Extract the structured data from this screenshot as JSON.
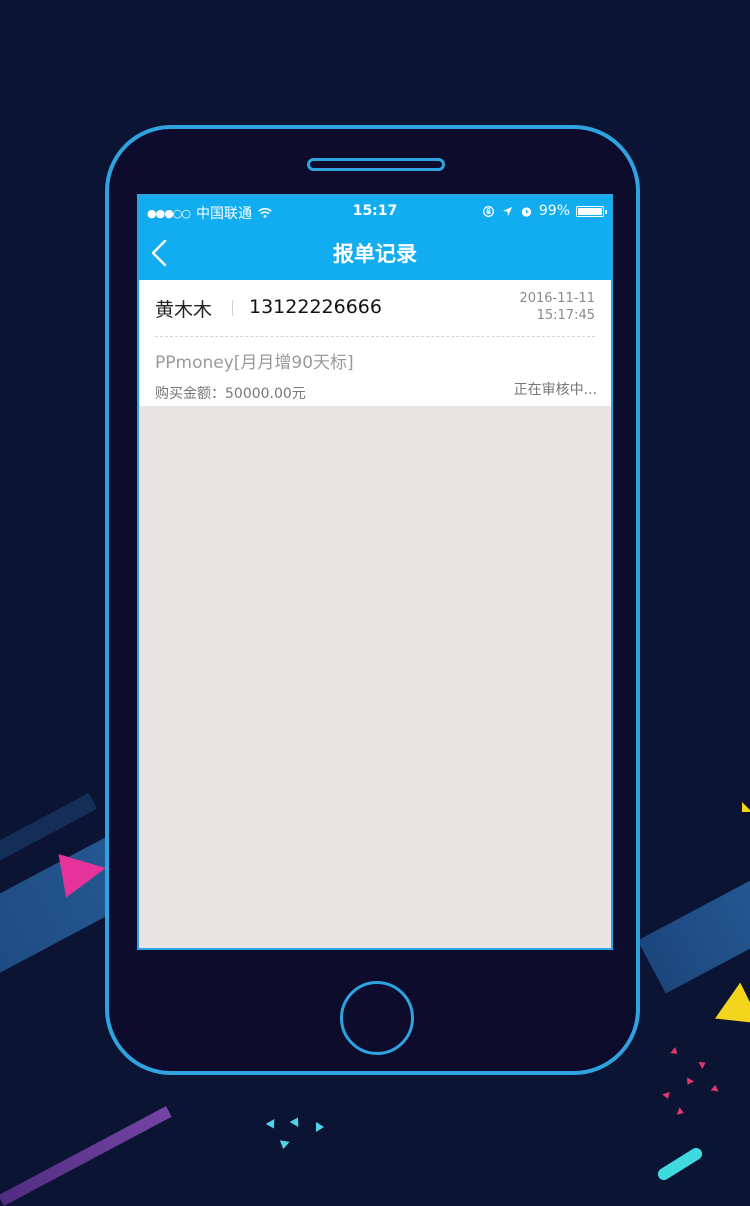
{
  "status_bar": {
    "signal": "●●●○○",
    "carrier": "中国联通",
    "time": "15:17",
    "battery": "99%",
    "battery_level": 0.99
  },
  "nav": {
    "title": "报单记录"
  },
  "records": [
    {
      "name": "黄木木",
      "phone": "13122226666",
      "date": "2016-11-11",
      "time": "15:17:45",
      "product": "PPmoney[月月增90天标]",
      "amount": "购买金额：50000.00元",
      "status": "正在审核中..."
    }
  ],
  "colors": {
    "background": "#0b1433",
    "phone_outline": "#2ea3e0",
    "header": "#12adf0",
    "list_background": "#e9e5e4"
  }
}
